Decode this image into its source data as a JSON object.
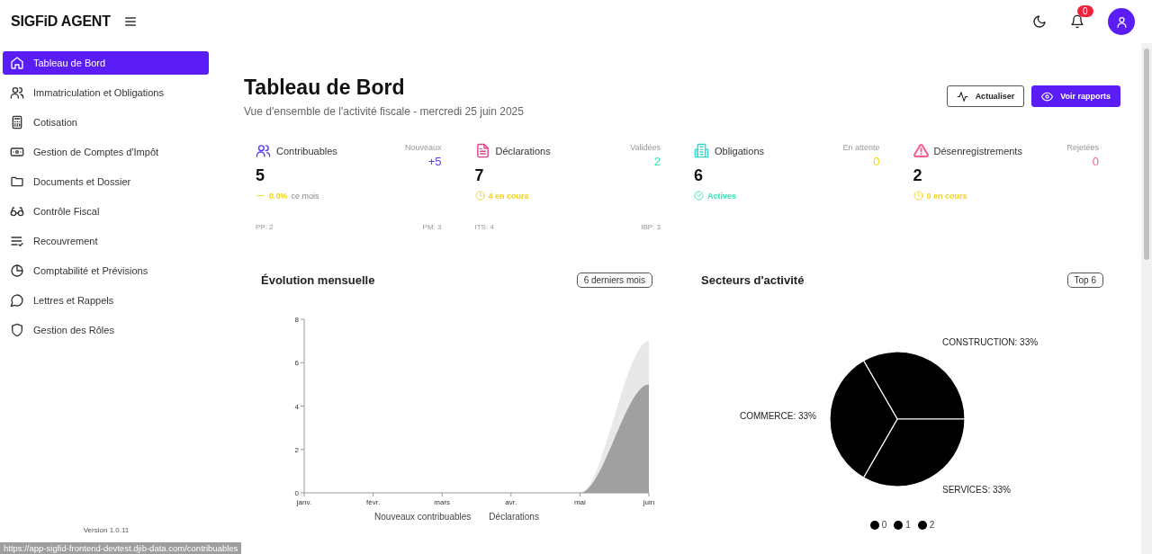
{
  "header": {
    "brand": "SIGFiD AGENT",
    "notifications": "0"
  },
  "sidebar": {
    "items": [
      {
        "label": "Tableau de Bord",
        "selected": true
      },
      {
        "label": "Immatriculation et Obligations",
        "selected": false
      },
      {
        "label": "Cotisation",
        "selected": false
      },
      {
        "label": "Gestion de Comptes d'Impôt",
        "selected": false
      },
      {
        "label": "Documents et Dossier",
        "selected": false
      },
      {
        "label": "Contrôle Fiscal",
        "selected": false
      },
      {
        "label": "Recouvrement",
        "selected": false
      },
      {
        "label": "Comptabilité et Prévisions",
        "selected": false
      },
      {
        "label": "Lettres et Rappels",
        "selected": false
      },
      {
        "label": "Gestion des Rôles",
        "selected": false
      }
    ],
    "version": "Version 1.0.11"
  },
  "page": {
    "title": "Tableau de Bord",
    "subtitle": "Vue d'ensemble de l'activité fiscale - mercredi 25 juin 2025",
    "actions": [
      {
        "label": "Actualiser",
        "kind": "outline"
      },
      {
        "label": "Voir rapports",
        "kind": "primary"
      }
    ]
  },
  "stats": [
    {
      "title": "Contribuables",
      "color": "#5b3df5",
      "value": "5",
      "side": {
        "label": "Nouveaux",
        "value": "+5",
        "color": "#5b3df5"
      },
      "status": {
        "kind": "trend",
        "text": "0.0%",
        "note": "ce mois",
        "color": "#f2d21b"
      },
      "footer_left": "PP: 2",
      "footer_right": "PM: 3"
    },
    {
      "title": "Déclarations",
      "color": "#e83e8c",
      "value": "7",
      "side": {
        "label": "Validées",
        "value": "2",
        "color": "#2ee6b0"
      },
      "status": {
        "kind": "clock",
        "text": "4 en cours",
        "color": "#f2d21b"
      },
      "footer_left": "ITS: 4",
      "footer_right": "IBP: 3"
    },
    {
      "title": "Obligations",
      "color": "#37d6c8",
      "value": "6",
      "side": {
        "label": "En attente",
        "value": "0",
        "color": "#f5d90a"
      },
      "status": {
        "kind": "check",
        "text": "Actives",
        "color": "#2ee6b0"
      }
    },
    {
      "title": "Désenregistrements",
      "color": "#f06292",
      "value": "2",
      "side": {
        "label": "Rejetées",
        "value": "0",
        "color": "#f06292"
      },
      "status": {
        "kind": "clock",
        "text": "0 en cours",
        "color": "#f2d21b"
      }
    }
  ],
  "charts": [
    {
      "title": "Évolution mensuelle",
      "badge": "6 derniers mois",
      "chart_data": {
        "type": "area",
        "categories": [
          "janv.",
          "févr.",
          "mars",
          "avr.",
          "mai",
          "juin"
        ],
        "ylim": [
          0,
          8
        ],
        "yticks": [
          0,
          2,
          4,
          6,
          8
        ],
        "series": [
          {
            "name": "Nouveaux contribuables",
            "color": "#a0a0a0",
            "values": [
              0,
              0,
              0,
              0,
              0,
              5
            ]
          },
          {
            "name": "Déclarations",
            "color": "#e8e8e8",
            "values": [
              0,
              0,
              0,
              0,
              0,
              7
            ]
          }
        ]
      }
    },
    {
      "title": "Secteurs d'activité",
      "badge": "Top 6",
      "chart_data": {
        "type": "pie",
        "series": [
          {
            "color": "#000000",
            "values": [
              33,
              33,
              33
            ]
          }
        ],
        "value_labels": [
          "CONSTRUCTION: 33%",
          "SERVICES: 33%",
          "COMMERCE: 33%"
        ]
      },
      "legend": [
        "0",
        "1",
        "2"
      ]
    }
  ],
  "status_bar": {
    "url": "https://app-sigfid-frontend-devtest.djib-data.com/contribuables"
  }
}
